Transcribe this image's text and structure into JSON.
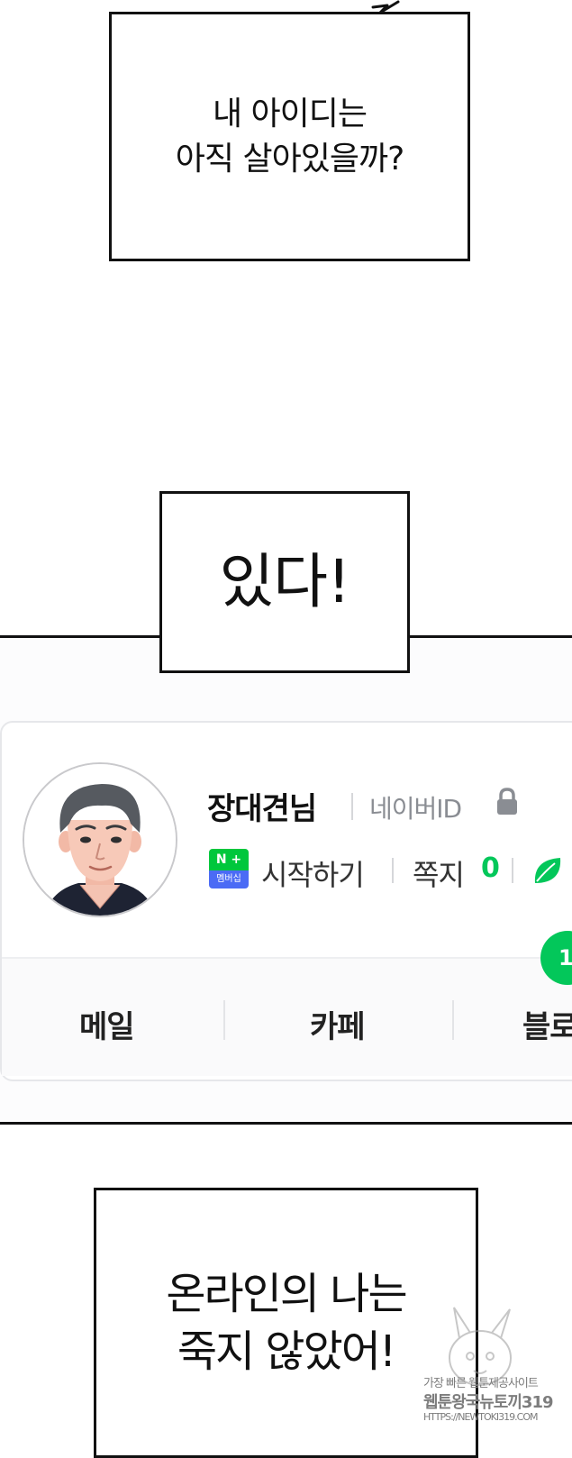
{
  "captions": {
    "top": {
      "lines": [
        "내 아이디는",
        "아직 살아있을까?"
      ]
    },
    "middle": {
      "text": "있다!"
    },
    "bottom": {
      "lines": [
        "온라인의 나는",
        "죽지 않았어!"
      ]
    }
  },
  "profile": {
    "name": "장대견님",
    "id_label": "네이버ID",
    "membership_badge_top": "N +",
    "membership_badge_bottom": "멤버십",
    "start_label": "시작하기",
    "messages_label": "쪽지",
    "messages_count": "0",
    "notification_count": "1"
  },
  "tabs": [
    "메일",
    "카페",
    "블로"
  ],
  "watermark": {
    "line1": "가장 빠른 웹툰제공사이트",
    "line2": "웹툰왕국뉴토끼319",
    "line3": "HTTPS://NEWTOKI319.COM"
  },
  "colors": {
    "naver_green": "#03c75a",
    "membership_blue": "#4b6bf5",
    "border": "#111111"
  },
  "icons": [
    "speech-tail-icon",
    "avatar-illustration",
    "lock-icon",
    "membership-badge-icon",
    "leaf-icon",
    "mascot-watermark"
  ]
}
